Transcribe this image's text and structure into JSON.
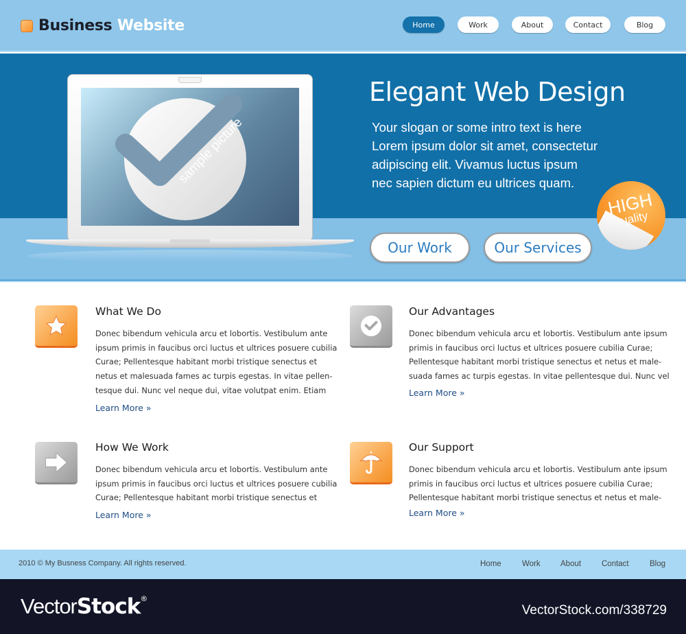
{
  "header": {
    "logo_dark": "Business",
    "logo_light": "Website",
    "nav": [
      {
        "label": "Home",
        "active": true
      },
      {
        "label": "Work",
        "active": false
      },
      {
        "label": "About",
        "active": false
      },
      {
        "label": "Contact",
        "active": false
      },
      {
        "label": "Blog",
        "active": false
      }
    ]
  },
  "hero": {
    "title": "Elegant Web Design",
    "text_lines": [
      "Your slogan or some intro text is here",
      "Lorem ipsum dolor sit amet, consectetur",
      "adipiscing elit. Vivamus luctus ipsum",
      "nec sapien dictum eu ultrices quam."
    ],
    "screen_caption": "sample picture",
    "buttons": [
      "Our Work",
      "Our Services"
    ],
    "badge_top": "HIGH",
    "badge_bottom": "Quality"
  },
  "features": [
    {
      "title": "What We Do",
      "icon": "star-icon",
      "lines": [
        "Donec bibendum vehicula arcu et lobortis. Vestibulum ante",
        "ipsum primis in faucibus orci luctus et ultrices posuere cubilia",
        "Curae; Pellentesque habitant morbi tristique senectus et",
        "netus et malesuada fames ac turpis egestas. In vitae pellen-",
        "tesque dui. Nunc vel neque dui, vitae volutpat enim. Etiam"
      ],
      "more": "Learn More »"
    },
    {
      "title": "Our Advantages",
      "icon": "check-icon",
      "lines": [
        "Donec bibendum vehicula arcu et lobortis. Vestibulum ante ipsum",
        "primis in faucibus orci luctus et ultrices posuere cubilia Curae;",
        "Pellentesque habitant morbi tristique senectus et netus et male-",
        "suada fames ac turpis egestas. In vitae pellentesque dui. Nunc vel"
      ],
      "more": "Learn More »"
    },
    {
      "title": "How We Work",
      "icon": "arrow-right-icon",
      "lines": [
        "Donec bibendum vehicula arcu et lobortis. Vestibulum ante",
        "ipsum primis in faucibus orci luctus et ultrices posuere cubilia",
        "Curae; Pellentesque habitant morbi tristique senectus et"
      ],
      "more": "Learn More »"
    },
    {
      "title": "Our Support",
      "icon": "umbrella-icon",
      "lines": [
        "Donec bibendum vehicula arcu et lobortis. Vestibulum ante ipsum",
        "primis in faucibus orci luctus et ultrices posuere cubilia Curae;",
        "Pellentesque habitant morbi tristique senectus et netus et male-"
      ],
      "more": "Learn More »"
    }
  ],
  "footer": {
    "copyright": "2010 © My Busness Company. All rights reserved.",
    "links": [
      "Home",
      "Work",
      "About",
      "Contact",
      "Blog"
    ]
  },
  "watermark": {
    "logo_thin": "Vector",
    "logo_bold": "Stock",
    "logo_mark": "®",
    "url": "VectorStock.com/338729"
  },
  "colors": {
    "header_bg": "#8fc6ea",
    "hero_bg": "#1270a8",
    "hero_band": "#84bfe6",
    "nav_active": "#1471aa",
    "accent_orange": "#f7952a",
    "link": "#204e86",
    "cta_text": "#2b7cc0",
    "footer_bg": "#a8d8f4",
    "watermark_bg": "#131527"
  }
}
